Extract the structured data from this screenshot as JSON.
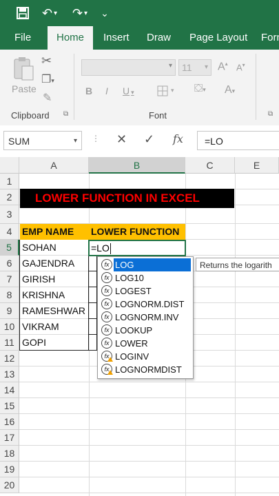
{
  "quick_access": {
    "undo_glyph": "↶",
    "redo_glyph": "↷",
    "more_glyph": "⌄"
  },
  "tabs": [
    "File",
    "Home",
    "Insert",
    "Draw",
    "Page Layout",
    "Form"
  ],
  "ribbon": {
    "paste_label": "Paste",
    "clipboard_label": "Clipboard",
    "font_label": "Font",
    "font_size": "11",
    "bold": "B",
    "italic": "I",
    "underline": "U",
    "grow_font": "A",
    "shrink_font": "A",
    "font_color": "A"
  },
  "formula_bar": {
    "name_box": "SUM",
    "cancel": "✕",
    "enter": "✓",
    "fx": "fx",
    "formula": "=LO"
  },
  "columns": [
    "A",
    "B",
    "C",
    "E"
  ],
  "rows": [
    "1",
    "2",
    "3",
    "4",
    "5",
    "6",
    "7",
    "8",
    "9",
    "10",
    "11",
    "12",
    "13",
    "14",
    "15",
    "16",
    "17",
    "18",
    "19",
    "20"
  ],
  "sheet": {
    "title": "LOWER FUNCTION IN EXCEL",
    "header_a": "EMP NAME",
    "header_b": "LOWER FUNCTION",
    "names": [
      "SOHAN",
      "GAJENDRA",
      "GIRISH",
      "KRISHNA",
      "RAMESHWAR",
      "VIKRAM",
      "GOPI"
    ],
    "active_input": "=LO"
  },
  "autocomplete": [
    {
      "label": "LOG",
      "selected": true,
      "warn": false
    },
    {
      "label": "LOG10",
      "selected": false,
      "warn": false
    },
    {
      "label": "LOGEST",
      "selected": false,
      "warn": false
    },
    {
      "label": "LOGNORM.DIST",
      "selected": false,
      "warn": false
    },
    {
      "label": "LOGNORM.INV",
      "selected": false,
      "warn": false
    },
    {
      "label": "LOOKUP",
      "selected": false,
      "warn": false
    },
    {
      "label": "LOWER",
      "selected": false,
      "warn": false
    },
    {
      "label": "LOGINV",
      "selected": false,
      "warn": true
    },
    {
      "label": "LOGNORMDIST",
      "selected": false,
      "warn": true
    }
  ],
  "tooltip": "Returns the logarith",
  "colors": {
    "excel_green": "#217346",
    "header_fill": "#ffc000",
    "title_fill": "#000000",
    "title_text": "#ff0000",
    "selection": "#0b6fd6"
  }
}
